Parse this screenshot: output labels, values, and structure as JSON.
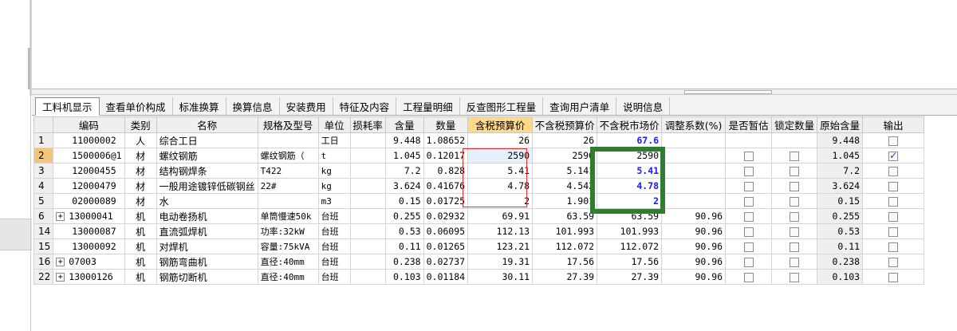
{
  "tabs": [
    {
      "label": "工料机显示",
      "active": true
    },
    {
      "label": "查看单价构成"
    },
    {
      "label": "标准换算"
    },
    {
      "label": "换算信息"
    },
    {
      "label": "安装费用"
    },
    {
      "label": "特征及内容"
    },
    {
      "label": "工程量明细"
    },
    {
      "label": "反查图形工程量"
    },
    {
      "label": "查询用户清单"
    },
    {
      "label": "说明信息"
    }
  ],
  "columns": [
    "编码",
    "类别",
    "名称",
    "规格及型号",
    "单位",
    "损耗率",
    "含量",
    "数量",
    "含税预算价",
    "不含税预算价",
    "不含税市场价",
    "调整系数(%)",
    "是否暂估",
    "锁定数量",
    "原始含量",
    "输出"
  ],
  "rows": [
    {
      "idx": "1",
      "code": "11000002",
      "type": "人",
      "name": "综合工日",
      "spec": "",
      "unit": "工日",
      "loss": "",
      "qty_ratio": "9.448",
      "qty": "1.08652",
      "tax_budget": "26",
      "notax_budget": "26",
      "notax_market": "67.6",
      "adj": "",
      "est": null,
      "lock": null,
      "orig": "9.448",
      "out": false,
      "expand": false,
      "market_blue": true
    },
    {
      "idx": "2",
      "code": "1500006@1",
      "type": "材",
      "name": "螺纹钢筋",
      "spec": "螺纹钢筋（",
      "unit": "t",
      "loss": "",
      "qty_ratio": "1.045",
      "qty": "0.12017",
      "tax_budget": "2590",
      "notax_budget": "2590",
      "notax_market": "2590",
      "adj": "",
      "est": false,
      "lock": false,
      "orig": "1.045",
      "out": true,
      "expand": false,
      "selected": true,
      "market_blue": false
    },
    {
      "idx": "3",
      "code": "12000455",
      "type": "材",
      "name": "结构钢焊条",
      "spec": "T422",
      "unit": "kg",
      "loss": "",
      "qty_ratio": "7.2",
      "qty": "0.828",
      "tax_budget": "5.41",
      "notax_budget": "5.141",
      "notax_market": "5.41",
      "adj": "",
      "est": false,
      "lock": false,
      "orig": "7.2",
      "out": false,
      "expand": false,
      "market_blue": true
    },
    {
      "idx": "4",
      "code": "12000479",
      "type": "材",
      "name": "一般用途镀锌低碳钢丝",
      "spec": "22#",
      "unit": "kg",
      "loss": "",
      "qty_ratio": "3.624",
      "qty": "0.41676",
      "tax_budget": "4.78",
      "notax_budget": "4.542",
      "notax_market": "4.78",
      "adj": "",
      "est": false,
      "lock": false,
      "orig": "3.624",
      "out": false,
      "expand": false,
      "market_blue": true
    },
    {
      "idx": "5",
      "code": "02000089",
      "type": "材",
      "name": "水",
      "spec": "",
      "unit": "m3",
      "loss": "",
      "qty_ratio": "0.15",
      "qty": "0.01725",
      "tax_budget": "2",
      "notax_budget": "1.901",
      "notax_market": "2",
      "adj": "",
      "est": false,
      "lock": false,
      "orig": "0.15",
      "out": false,
      "expand": false,
      "market_blue": true
    },
    {
      "idx": "6",
      "code": "13000041",
      "type": "机",
      "name": "电动卷扬机",
      "spec": "单筒慢速50k",
      "unit": "台班",
      "loss": "",
      "qty_ratio": "0.255",
      "qty": "0.02932",
      "tax_budget": "69.91",
      "notax_budget": "63.59",
      "notax_market": "63.59",
      "adj": "90.96",
      "est": false,
      "lock": false,
      "orig": "0.255",
      "out": false,
      "expand": true,
      "market_blue": false
    },
    {
      "idx": "14",
      "code": "13000087",
      "type": "机",
      "name": "直流弧焊机",
      "spec": "功率:32kW",
      "unit": "台班",
      "loss": "",
      "qty_ratio": "0.53",
      "qty": "0.06095",
      "tax_budget": "112.13",
      "notax_budget": "101.993",
      "notax_market": "101.993",
      "adj": "90.96",
      "est": false,
      "lock": false,
      "orig": "0.53",
      "out": false,
      "expand": false,
      "market_blue": false
    },
    {
      "idx": "15",
      "code": "13000092",
      "type": "机",
      "name": "对焊机",
      "spec": "容量:75kVA",
      "unit": "台班",
      "loss": "",
      "qty_ratio": "0.11",
      "qty": "0.01265",
      "tax_budget": "123.21",
      "notax_budget": "112.072",
      "notax_market": "112.072",
      "adj": "90.96",
      "est": false,
      "lock": false,
      "orig": "0.11",
      "out": false,
      "expand": false,
      "market_blue": false
    },
    {
      "idx": "16",
      "code": "07003",
      "type": "机",
      "name": "钢筋弯曲机",
      "spec": "直径:40mm",
      "unit": "台班",
      "loss": "",
      "qty_ratio": "0.238",
      "qty": "0.02737",
      "tax_budget": "19.31",
      "notax_budget": "17.56",
      "notax_market": "17.56",
      "adj": "90.96",
      "est": false,
      "lock": false,
      "orig": "0.238",
      "out": false,
      "expand": true,
      "market_blue": false
    },
    {
      "idx": "22",
      "code": "13000126",
      "type": "机",
      "name": "钢筋切断机",
      "spec": "直径:40mm",
      "unit": "台班",
      "loss": "",
      "qty_ratio": "0.103",
      "qty": "0.01184",
      "tax_budget": "30.11",
      "notax_budget": "27.39",
      "notax_market": "27.39",
      "adj": "90.96",
      "est": false,
      "lock": false,
      "orig": "0.103",
      "out": false,
      "expand": true,
      "market_blue": false
    }
  ],
  "colors": {
    "highlight_header": "#ffd98a",
    "blue_value": "#1a1aff",
    "red_box": "#e03030",
    "green_box": "#2e7d32"
  }
}
